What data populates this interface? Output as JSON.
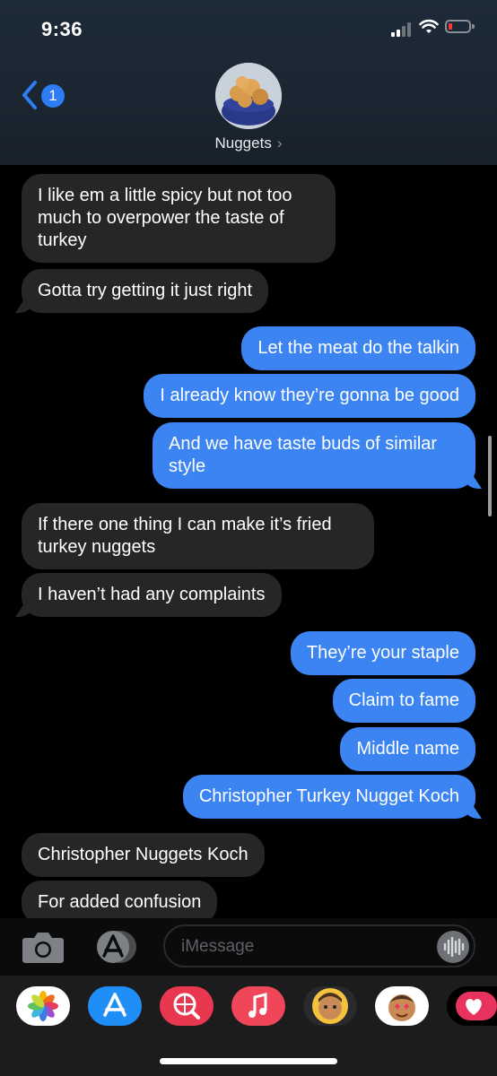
{
  "status_bar": {
    "time": "9:36"
  },
  "nav": {
    "back_badge": "1",
    "contact_name": "Nuggets",
    "contact_chevron": "›"
  },
  "messages": [
    {
      "from": "them",
      "text": "I like em a little spicy but not too much to overpower the taste of turkey"
    },
    {
      "from": "them",
      "text": "Gotta try getting it just right"
    },
    {
      "from": "me",
      "text": "Let the meat do the talkin"
    },
    {
      "from": "me",
      "text": "I already know they’re gonna be good"
    },
    {
      "from": "me",
      "text": "And we have taste buds of similar style"
    },
    {
      "from": "them",
      "text": "If there one thing I can make it’s fried turkey nuggets"
    },
    {
      "from": "them",
      "text": "I haven’t had any complaints"
    },
    {
      "from": "me",
      "text": "They’re your staple"
    },
    {
      "from": "me",
      "text": "Claim to fame"
    },
    {
      "from": "me",
      "text": "Middle name"
    },
    {
      "from": "me",
      "text": "Christopher Turkey Nugget Koch"
    },
    {
      "from": "them",
      "text": "Christopher Nuggets Koch"
    },
    {
      "from": "them",
      "text": "For added confusion"
    }
  ],
  "compose": {
    "placeholder": "iMessage",
    "value": ""
  },
  "app_drawer": [
    "photos-app",
    "app-store-app",
    "web-search-app",
    "music-app",
    "memoji-app",
    "memoji-stickers-app",
    "digital-touch-app"
  ],
  "colors": {
    "outgoing": "#3b84f2",
    "incoming": "#262629",
    "accent": "#2f7df2"
  }
}
